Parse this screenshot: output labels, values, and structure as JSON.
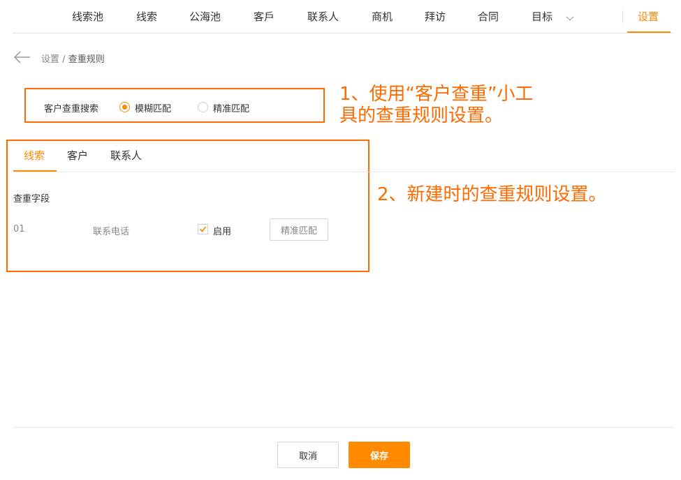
{
  "nav": {
    "items": [
      "线索池",
      "线索",
      "公海池",
      "客戶",
      "联系人",
      "商机",
      "拜访",
      "合同",
      "目标"
    ],
    "more_icon": "chevron-down-icon",
    "settings_label": "设置"
  },
  "breadcrumb": {
    "back_icon": "arrow-left-icon",
    "parent": "设置",
    "separator": "/",
    "current": "查重规则"
  },
  "customer_dedupe": {
    "label": "客户查重搜索",
    "options": [
      {
        "label": "模糊匹配",
        "selected": true
      },
      {
        "label": "精准匹配",
        "selected": false
      }
    ]
  },
  "annotations": {
    "note1_line1": "1、使用“客户查重”小工",
    "note1_line2": "具的查重规则设置。",
    "note2": "2、新建时的查重规则设置。"
  },
  "tabs": [
    {
      "label": "线索",
      "active": true
    },
    {
      "label": "客户",
      "active": false
    },
    {
      "label": "联系人",
      "active": false
    }
  ],
  "dedupe_fields": {
    "heading": "查重字段",
    "rows": [
      {
        "index": "01",
        "field": "联系电话",
        "enabled": true,
        "enabled_label": "启用",
        "match_label": "精准匹配"
      }
    ]
  },
  "footer": {
    "cancel_label": "取消",
    "save_label": "保存"
  },
  "colors": {
    "accent": "#ff8a00",
    "annotation": "#ff6a00"
  }
}
